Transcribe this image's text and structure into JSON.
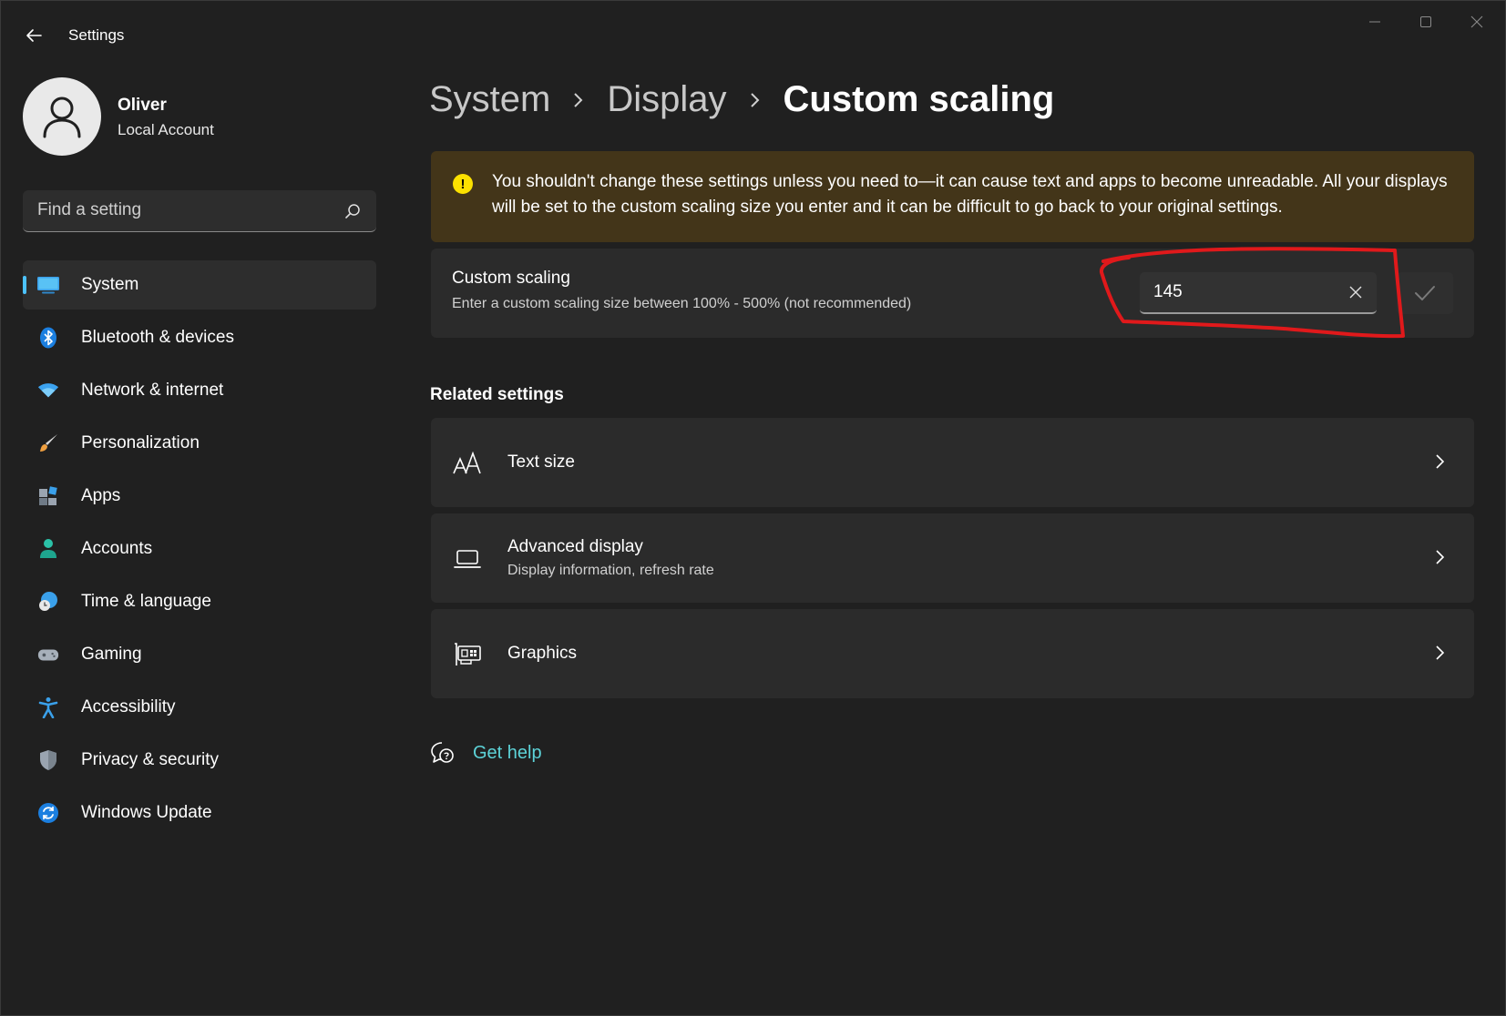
{
  "window": {
    "title": "Settings"
  },
  "profile": {
    "name": "Oliver",
    "account_type": "Local Account"
  },
  "search": {
    "placeholder": "Find a setting",
    "value": ""
  },
  "sidebar": {
    "items": [
      {
        "label": "System",
        "icon": "system-icon",
        "active": true
      },
      {
        "label": "Bluetooth & devices",
        "icon": "bluetooth-icon"
      },
      {
        "label": "Network & internet",
        "icon": "wifi-icon"
      },
      {
        "label": "Personalization",
        "icon": "brush-icon"
      },
      {
        "label": "Apps",
        "icon": "apps-icon"
      },
      {
        "label": "Accounts",
        "icon": "person-icon"
      },
      {
        "label": "Time & language",
        "icon": "clock-globe-icon"
      },
      {
        "label": "Gaming",
        "icon": "gamepad-icon"
      },
      {
        "label": "Accessibility",
        "icon": "accessibility-icon"
      },
      {
        "label": "Privacy & security",
        "icon": "shield-icon"
      },
      {
        "label": "Windows Update",
        "icon": "update-icon"
      }
    ]
  },
  "breadcrumb": {
    "items": [
      "System",
      "Display"
    ],
    "current": "Custom scaling"
  },
  "warning": {
    "text": "You shouldn't change these settings unless you need to—it can cause text and apps to become unreadable. All your displays will be set to the custom scaling size you enter and it can be difficult to go back to your original settings."
  },
  "custom_scaling": {
    "title": "Custom scaling",
    "subtitle": "Enter a custom scaling size between 100% - 500% (not recommended)",
    "value": "145"
  },
  "related": {
    "title": "Related settings",
    "items": [
      {
        "label": "Text size",
        "sub": "",
        "icon": "text-size-icon"
      },
      {
        "label": "Advanced display",
        "sub": "Display information, refresh rate",
        "icon": "laptop-icon"
      },
      {
        "label": "Graphics",
        "sub": "",
        "icon": "graphics-card-icon"
      }
    ]
  },
  "help": {
    "label": "Get help"
  },
  "colors": {
    "background": "#202020",
    "card": "#2b2b2b",
    "accent": "#4cc2ff",
    "warning_bg": "#433519",
    "warning_icon": "#fce100",
    "link": "#5dd3d8",
    "annotation": "#e0191b"
  }
}
